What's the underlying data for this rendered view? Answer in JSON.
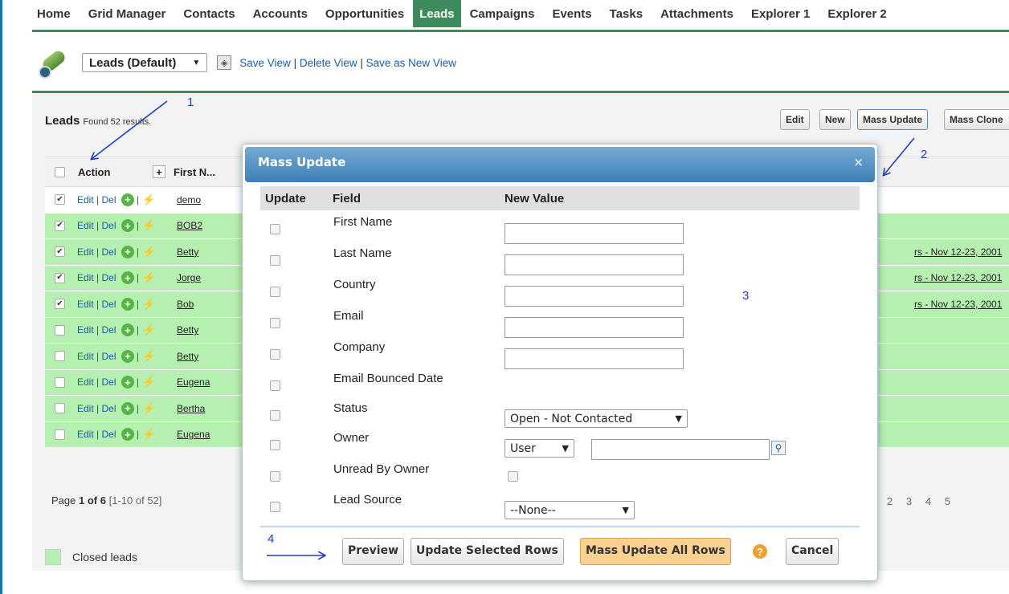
{
  "nav": {
    "tabs": [
      "Home",
      "Grid Manager",
      "Contacts",
      "Accounts",
      "Opportunities",
      "Leads",
      "Campaigns",
      "Events",
      "Tasks",
      "Attachments",
      "Explorer 1",
      "Explorer 2"
    ],
    "active": "Leads"
  },
  "viewbar": {
    "selected_view": "Leads (Default)",
    "save_view": "Save View",
    "delete_view": "Delete View",
    "save_as_new": "Save as New View"
  },
  "panel": {
    "title": "Leads",
    "found_text": "Found 52 results.",
    "buttons": {
      "edit": "Edit",
      "new": "New",
      "mass_update": "Mass Update",
      "mass_clone": "Mass Clone"
    }
  },
  "grid": {
    "columns": {
      "action": "Action",
      "first_name": "First N..."
    },
    "add_icon": "+",
    "action_labels": {
      "edit": "Edit",
      "sep": "|",
      "del": "Del"
    },
    "rows": [
      {
        "name": "demo",
        "checked": true,
        "green": false,
        "campaign": ""
      },
      {
        "name": "BOB2",
        "checked": true,
        "green": true,
        "campaign": ""
      },
      {
        "name": "Betty",
        "checked": true,
        "green": true,
        "campaign": "rs - Nov 12-23, 2001"
      },
      {
        "name": "Jorge",
        "checked": true,
        "green": true,
        "campaign": "rs - Nov 12-23, 2001"
      },
      {
        "name": "Bob",
        "checked": true,
        "green": true,
        "campaign": "rs - Nov 12-23, 2001"
      },
      {
        "name": "Betty",
        "checked": false,
        "green": true,
        "campaign": ""
      },
      {
        "name": "Betty",
        "checked": false,
        "green": true,
        "campaign": ""
      },
      {
        "name": "Eugena",
        "checked": false,
        "green": true,
        "campaign": ""
      },
      {
        "name": "Bertha",
        "checked": false,
        "green": true,
        "campaign": ""
      },
      {
        "name": "Eugena",
        "checked": false,
        "green": true,
        "campaign": ""
      }
    ]
  },
  "pager": {
    "page_label": "Page",
    "page": "1",
    "of_label": "of",
    "total_pages": "6",
    "range": "[1-10 of 52]",
    "pages": [
      "2",
      "3",
      "4",
      "5"
    ]
  },
  "legend": {
    "label": "Closed leads",
    "color": "#b6f0b0"
  },
  "modal": {
    "title": "Mass Update",
    "close": "×",
    "headers": {
      "update": "Update",
      "field": "Field",
      "new_value": "New Value"
    },
    "fields": {
      "first_name": "First Name",
      "last_name": "Last Name",
      "country": "Country",
      "email": "Email",
      "company": "Company",
      "email_bounced": "Email Bounced Date",
      "status": "Status",
      "owner": "Owner",
      "unread": "Unread By Owner",
      "lead_source": "Lead Source"
    },
    "status_value": "Open - Not Contacted",
    "owner_type": "User",
    "lead_source_value": "--None--",
    "buttons": {
      "preview": "Preview",
      "update_selected": "Update Selected Rows",
      "mass_update_all": "Mass Update All Rows",
      "help": "?",
      "cancel": "Cancel"
    }
  },
  "annotations": [
    "1",
    "2",
    "3",
    "4"
  ],
  "colors": {
    "accent_green": "#3e8c5e",
    "closed_lead": "#b6f0b0",
    "link": "#1a5ea8",
    "modal_header": "#3e7fb8",
    "annotation": "#1f3fc6"
  }
}
